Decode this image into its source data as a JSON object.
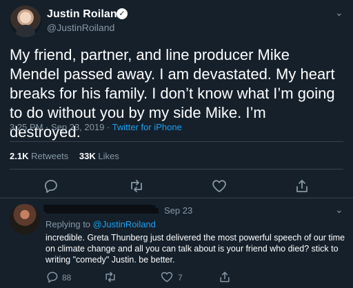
{
  "tweet": {
    "author_name": "Justin Roiland",
    "handle": "@JustinRoiland",
    "text": "My friend, partner, and line producer Mike Mendel passed away. I am devastated. My heart breaks for his family. I don’t know what I’m going to do without you by my side Mike. I’m destroyed.",
    "time": "3:25 PM · Sep 23, 2019 · ",
    "source": "Twitter for iPhone",
    "retweets_count": "2.1K",
    "retweets_label": "Retweets",
    "likes_count": "33K",
    "likes_label": "Likes"
  },
  "reply": {
    "date": "Sep 23",
    "replying_prefix": "Replying to ",
    "replying_mention": "@JustinRoiland",
    "text": "incredible. Greta Thunberg just delivered the most powerful speech of our time on climate change and all you can talk about is your friend who died? stick to writing \"comedy\" Justin. be better.",
    "reply_count": "88",
    "like_count": "7"
  },
  "icons": {
    "verified": "verified-badge-icon",
    "chevron": "chevron-down-icon",
    "reply": "reply-icon",
    "retweet": "retweet-icon",
    "like": "heart-icon",
    "share": "share-icon"
  },
  "colors": {
    "background": "#15202b",
    "text": "#ffffff",
    "muted": "#8899a6",
    "accent": "#1da1f2",
    "divider": "#38444d"
  }
}
